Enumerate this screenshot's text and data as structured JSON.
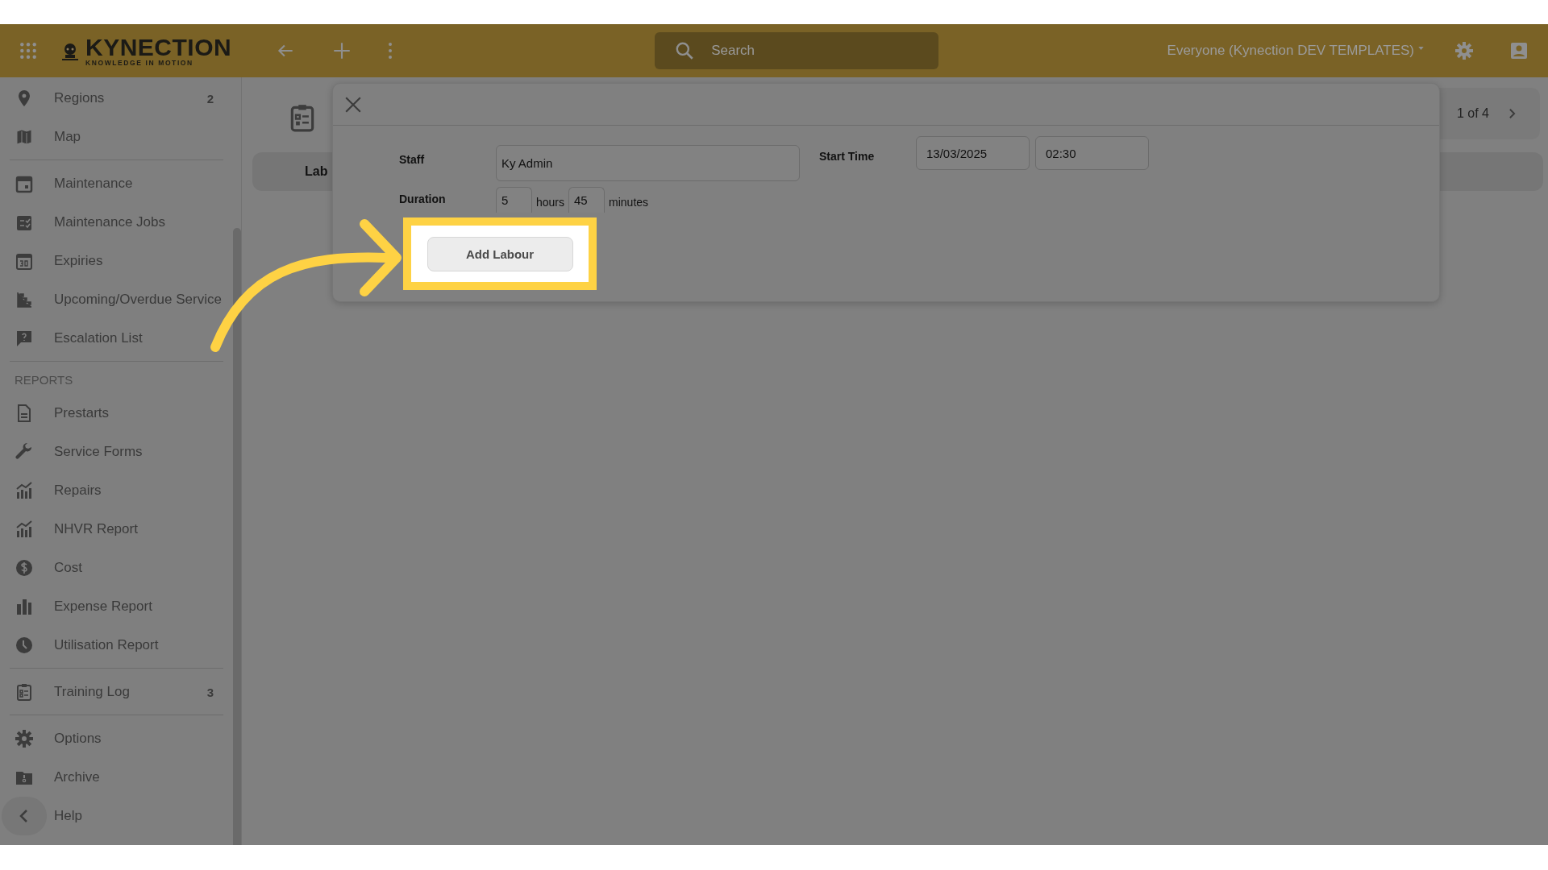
{
  "header": {
    "logo": {
      "name": "KYNECTION",
      "tagline": "KNOWLEDGE IN MOTION"
    },
    "search": {
      "placeholder": "Search"
    },
    "account": "Everyone (Kynection DEV TEMPLATES)"
  },
  "sidebar": {
    "sections": [
      {
        "items": [
          {
            "label": "Regions",
            "count": "2"
          },
          {
            "label": "Map"
          }
        ]
      },
      {
        "items": [
          {
            "label": "Maintenance"
          },
          {
            "label": "Maintenance Jobs"
          },
          {
            "label": "Expiries"
          },
          {
            "label": "Upcoming/Overdue Service"
          },
          {
            "label": "Escalation List"
          }
        ]
      },
      {
        "heading": "REPORTS",
        "items": [
          {
            "label": "Prestarts"
          },
          {
            "label": "Service Forms"
          },
          {
            "label": "Repairs"
          },
          {
            "label": "NHVR Report"
          },
          {
            "label": "Cost"
          },
          {
            "label": "Expense Report"
          },
          {
            "label": "Utilisation Report"
          }
        ]
      },
      {
        "items": [
          {
            "label": "Training Log",
            "count": "3"
          }
        ]
      },
      {
        "items": [
          {
            "label": "Options"
          },
          {
            "label": "Archive"
          },
          {
            "label": "Help"
          }
        ]
      }
    ]
  },
  "page": {
    "tab": "Lab",
    "pager": "1 of 4"
  },
  "dialog": {
    "staff": {
      "label": "Staff",
      "value": "Ky Admin"
    },
    "start_time": {
      "label": "Start Time",
      "date": "13/03/2025",
      "time": "02:30"
    },
    "duration": {
      "label": "Duration",
      "hours": "5",
      "hours_unit": "hours",
      "minutes": "45",
      "minutes_unit": "minutes"
    },
    "button": "Add Labour"
  }
}
